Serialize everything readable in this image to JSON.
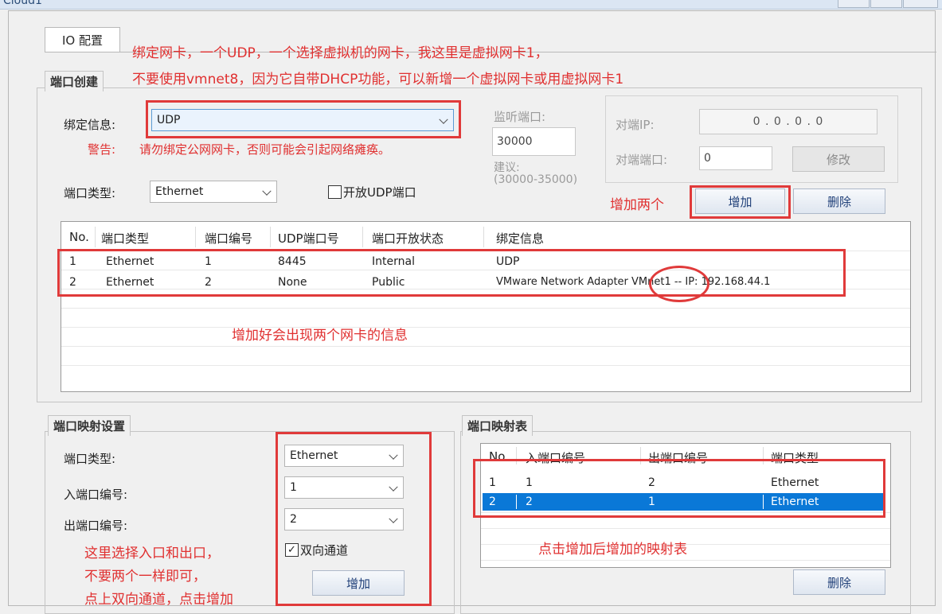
{
  "window": {
    "title": "Cloud1"
  },
  "tabs": [
    {
      "label": "IO 配置"
    }
  ],
  "port_create": {
    "title": "端口创建",
    "bind_label": "绑定信息:",
    "bind_value": "UDP",
    "warn_label": "警告:",
    "warn_text": "请勿绑定公网网卡，否则可能会引起网络瘫痪。",
    "listen_label": "监听端口:",
    "listen_value": "30000",
    "suggest_label": "建议:",
    "suggest_range": "(30000-35000)",
    "peer_ip_label": "对端IP:",
    "peer_ip_value": "0 . 0 . 0 . 0",
    "peer_port_label": "对端端口:",
    "peer_port_value": "0",
    "modify_button": "修改",
    "port_type_label": "端口类型:",
    "port_type_value": "Ethernet",
    "open_udp_label": "开放UDP端口",
    "add_button": "增加",
    "delete_button": "删除",
    "table_headers": [
      "No.",
      "端口类型",
      "端口编号",
      "UDP端口号",
      "端口开放状态",
      "绑定信息"
    ],
    "rows": [
      [
        "1",
        "Ethernet",
        "1",
        "8445",
        "Internal",
        "UDP"
      ],
      [
        "2",
        "Ethernet",
        "2",
        "None",
        "Public",
        "VMware Network Adapter VMnet1 -- IP: 192.168.44.1"
      ]
    ]
  },
  "mapping_settings": {
    "title": "端口映射设置",
    "port_type_label": "端口类型:",
    "port_type_value": "Ethernet",
    "in_port_label": "入端口编号:",
    "in_port_value": "1",
    "out_port_label": "出端口编号:",
    "out_port_value": "2",
    "bidirectional_label": "双向通道",
    "bidirectional_checked": true,
    "add_button": "增加"
  },
  "mapping_table": {
    "title": "端口映射表",
    "headers": [
      "No.",
      "入端口编号",
      "出端口编号",
      "端口类型"
    ],
    "rows": [
      [
        "1",
        "1",
        "2",
        "Ethernet"
      ],
      [
        "2",
        "2",
        "1",
        "Ethernet"
      ]
    ],
    "delete_button": "删除"
  },
  "annotations": {
    "a1_line1": "绑定网卡，一个UDP，一个选择虚拟机的网卡，我这里是虚拟网卡1，",
    "a1_line2": "不要使用vmnet8，因为它自带DHCP功能，可以新增一个虚拟网卡或用虚拟网卡1",
    "a2": "增加两个",
    "a3": "增加好会出现两个网卡的信息",
    "a4_line1": "这里选择入口和出口，",
    "a4_line2": "不要两个一样即可，",
    "a4_line3": "点上双向通道，点击增加",
    "a5": "点击增加后增加的映射表"
  },
  "colors": {
    "annotation": "#e03030",
    "selection": "#0a78d7"
  }
}
